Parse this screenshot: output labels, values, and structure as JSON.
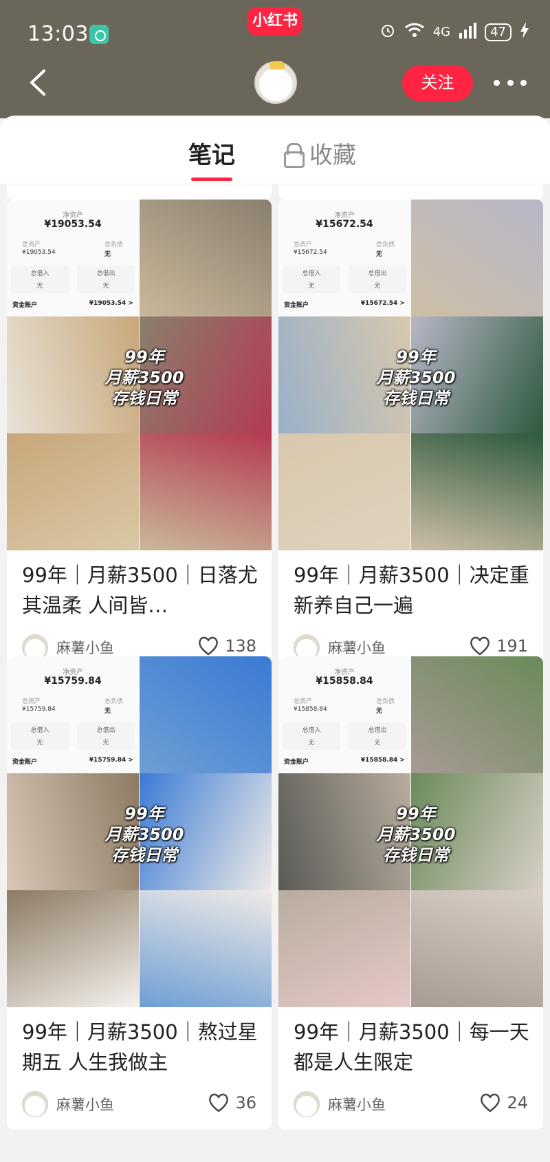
{
  "status_bar": {
    "time": "13:03",
    "center_logo": "小红书",
    "network": "4G",
    "battery": "47"
  },
  "header": {
    "follow_label": "关注"
  },
  "tabs": {
    "notes_label": "笔记",
    "collections_label": "收藏"
  },
  "notes": [
    {
      "title": "99年｜月薪3500｜日落尤其温柔 人间皆…",
      "author": "麻薯小鱼",
      "likes": "138",
      "cover_overlay": [
        "99年",
        "月薪3500",
        "存钱日常"
      ],
      "asset_label": "净资产",
      "net_assets": "¥19053.54",
      "total_assets_label": "总资产",
      "total_assets": "¥19053.54",
      "total_debt_label": "总负债",
      "total_debt": "无",
      "borrow_in_label": "总借入",
      "borrow_in": "无",
      "lend_out_label": "总借出",
      "lend_out": "无",
      "account_label": "资金账户",
      "account_value": "¥19053.54 >",
      "colors": [
        "#c9b89a",
        "#e8e2d6",
        "#8a7f6e",
        "#c8a77a",
        "#b43b52",
        "#d9c8a6"
      ]
    },
    {
      "title": "99年｜月薪3500｜决定重新养自己一遍",
      "author": "麻薯小鱼",
      "likes": "191",
      "cover_overlay": [
        "99年",
        "月薪3500",
        "存钱日常"
      ],
      "asset_label": "净资产",
      "net_assets": "¥15672.54",
      "total_assets_label": "总资产",
      "total_assets": "¥15672.54",
      "total_debt_label": "总负债",
      "total_debt": "无",
      "borrow_in_label": "总借入",
      "borrow_in": "无",
      "lend_out_label": "总借出",
      "lend_out": "无",
      "account_label": "资金账户",
      "account_value": "¥15672.54 >",
      "colors": [
        "#cdbfa6",
        "#9ab0c8",
        "#b8b6c8",
        "#d7c8ad",
        "#2e5a3e",
        "#e0d2bd"
      ]
    },
    {
      "title": "99年｜月薪3500｜熬过星期五 人生我做主",
      "author": "麻薯小鱼",
      "likes": "36",
      "cover_overlay": [
        "99年",
        "月薪3500",
        "存钱日常"
      ],
      "asset_label": "净资产",
      "net_assets": "¥15759.84",
      "total_assets_label": "总资产",
      "total_assets": "¥15759.84",
      "total_debt_label": "总负债",
      "total_debt": "无",
      "borrow_in_label": "总借入",
      "borrow_in": "无",
      "lend_out_label": "总借出",
      "lend_out": "无",
      "account_label": "资金账户",
      "account_value": "¥15759.84 >",
      "colors": [
        "#6e9ed4",
        "#d9c6b6",
        "#3a7bd5",
        "#8c7a62",
        "#efeae6",
        "#f5f2ee"
      ]
    },
    {
      "title": "99年｜月薪3500｜每一天都是人生限定",
      "author": "麻薯小鱼",
      "likes": "24",
      "cover_overlay": [
        "99年",
        "月薪3500",
        "存钱日常"
      ],
      "asset_label": "净资产",
      "net_assets": "¥15858.84",
      "total_assets_label": "总资产",
      "total_assets": "¥15858.84",
      "total_debt_label": "总负债",
      "total_debt": "无",
      "borrow_in_label": "总借入",
      "borrow_in": "无",
      "lend_out_label": "总借出",
      "lend_out": "无",
      "account_label": "资金账户",
      "account_value": "¥15858.84 >",
      "colors": [
        "#a89a94",
        "#5a5a56",
        "#6a8a5a",
        "#b8ad9e",
        "#d7cfc6",
        "#e6c8c8"
      ]
    }
  ],
  "theme": {
    "accent": "#ff2442",
    "header_bg": "#6a6659"
  }
}
